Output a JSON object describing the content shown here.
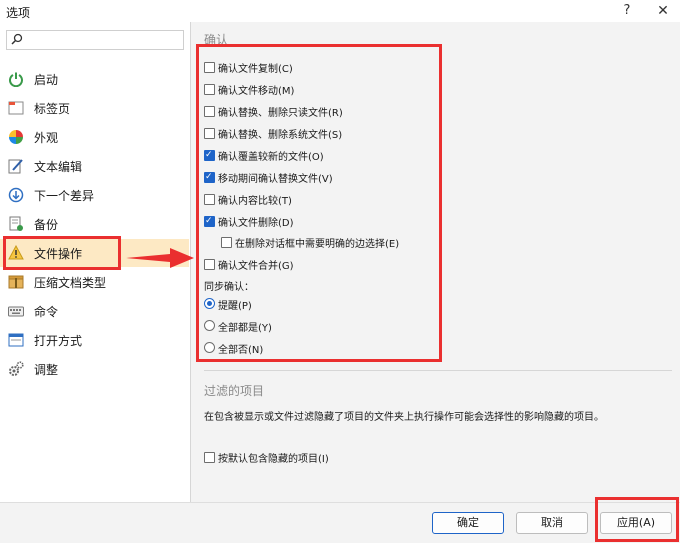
{
  "window": {
    "title": "选项",
    "help_label": "?",
    "close_label": "✕"
  },
  "sidebar": {
    "search_placeholder": "",
    "items": [
      {
        "label": "启动",
        "icon": "power-icon"
      },
      {
        "label": "标签页",
        "icon": "tabs-icon"
      },
      {
        "label": "外观",
        "icon": "palette-icon"
      },
      {
        "label": "文本编辑",
        "icon": "edit-icon"
      },
      {
        "label": "下一个差异",
        "icon": "arrow-down-icon"
      },
      {
        "label": "备份",
        "icon": "backup-icon"
      },
      {
        "label": "文件操作",
        "icon": "warning-icon",
        "selected": true
      },
      {
        "label": "压缩文档类型",
        "icon": "archive-icon"
      },
      {
        "label": "命令",
        "icon": "keyboard-icon"
      },
      {
        "label": "打开方式",
        "icon": "window-icon"
      },
      {
        "label": "调整",
        "icon": "gears-icon"
      }
    ]
  },
  "confirm": {
    "title": "确认",
    "options": [
      {
        "label": "确认文件复制(C)",
        "checked": false
      },
      {
        "label": "确认文件移动(M)",
        "checked": false
      },
      {
        "label": "确认替换、删除只读文件(R)",
        "checked": false
      },
      {
        "label": "确认替换、删除系统文件(S)",
        "checked": false
      },
      {
        "label": "确认覆盖较新的文件(O)",
        "checked": true
      },
      {
        "label": "移动期间确认替换文件(V)",
        "checked": true
      },
      {
        "label": "确认内容比较(T)",
        "checked": false
      },
      {
        "label": "确认文件删除(D)",
        "checked": true
      },
      {
        "label": "在删除对话框中需要明确的边选择(E)",
        "checked": false
      },
      {
        "label": "确认文件合并(G)",
        "checked": false
      }
    ],
    "sync_label": "同步确认：",
    "sync_options": [
      {
        "label": "提醒(P)",
        "selected": true
      },
      {
        "label": "全部都是(Y)",
        "selected": false
      },
      {
        "label": "全部否(N)",
        "selected": false
      }
    ]
  },
  "filter": {
    "title": "过滤的项目",
    "description": "在包含被显示或文件过滤隐藏了项目的文件夹上执行操作可能会选择性的影响隐藏的项目。",
    "option": {
      "label": "按默认包含隐藏的项目(I)",
      "checked": false
    }
  },
  "footer": {
    "ok_label": "确定",
    "cancel_label": "取消",
    "apply_label": "应用(A)"
  },
  "colors": {
    "annotation": "#ea2f2f",
    "accent": "#1e64c8",
    "selected_bg": "#fde9c4"
  }
}
